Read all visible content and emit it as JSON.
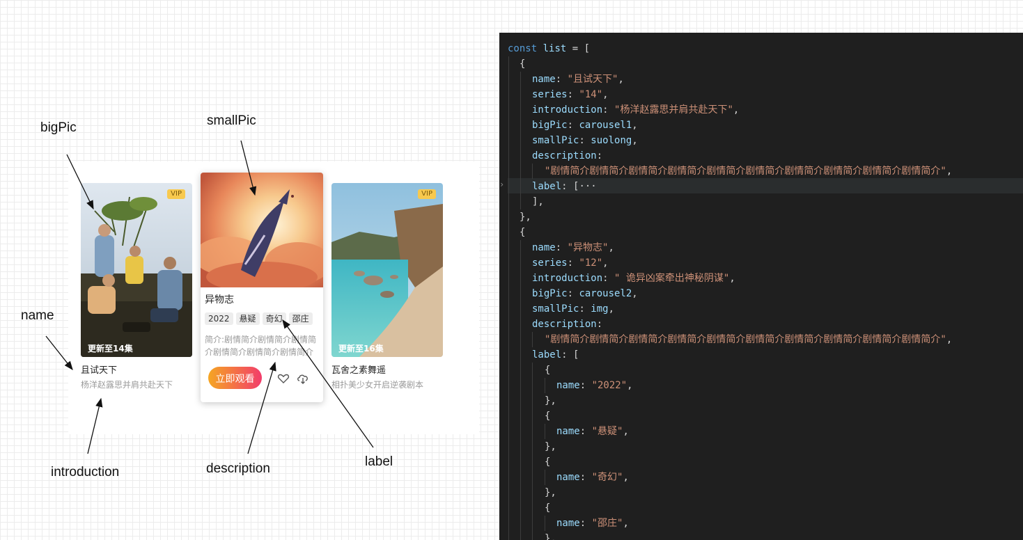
{
  "cards": [
    {
      "name": "且试天下",
      "introduction": "杨洋赵露思并肩共赴天下",
      "update": "更新至14集",
      "badge": "VIP"
    },
    {
      "name": "异物志",
      "labels": [
        "2022",
        "悬疑",
        "奇幻",
        "邵庄"
      ],
      "description": "简介:剧情简介剧情简介剧情简介剧情简介剧情简介剧情简介剧情简介剧情简介剧情简介剧情简介",
      "watch_label": "立即观看"
    },
    {
      "name": "瓦舍之素舞遥",
      "introduction": "相扑美少女开启逆袭剧本",
      "update": "更新至16集",
      "badge": "VIP"
    }
  ],
  "annotations": {
    "bigPic": "bigPic",
    "smallPic": "smallPic",
    "name": "name",
    "introduction": "introduction",
    "description": "description",
    "label": "label"
  },
  "code": {
    "const_kw": "const",
    "var_name": "list",
    "open": " = [",
    "obj1": {
      "name": "\"且试天下\"",
      "series": "\"14\"",
      "introduction": "\"杨洋赵露思并肩共赴天下\"",
      "bigPic": "carousel1",
      "smallPic": "suolong",
      "description": "\"剧情简介剧情简介剧情简介剧情简介剧情简介剧情简介剧情简介剧情简介剧情简介剧情简介\"",
      "label_folded": "[···"
    },
    "obj2": {
      "name": "\"异物志\"",
      "series": "\"12\"",
      "introduction": "\" 诡异凶案牵出神秘阴谋\"",
      "bigPic": "carousel2",
      "smallPic": "img",
      "description": "\"剧情简介剧情简介剧情简介剧情简介剧情简介剧情简介剧情简介剧情简介剧情简介剧情简介\"",
      "labels": [
        "\"2022\"",
        "\"悬疑\"",
        "\"奇幻\"",
        "\"邵庄\""
      ]
    }
  },
  "colors": {
    "vip_badge": "#f8c94e",
    "watch_gradient_start": "#f5a623",
    "watch_gradient_end": "#f23c6b",
    "editor_bg": "#1f1f1f",
    "string": "#ce9178",
    "keyword": "#569cd6",
    "property": "#9cdcfe"
  }
}
